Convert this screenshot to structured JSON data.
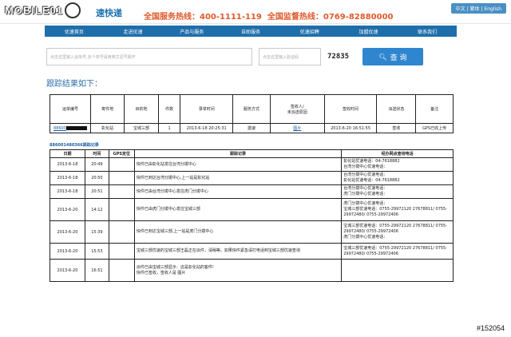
{
  "header": {
    "logo_text": "MOBILE01",
    "brand": "速快递",
    "hotline": "全国服务热线：400-1111-119",
    "supervise": "全国监督热线：0769-82880000",
    "lang": "中文 | 繁体 | English"
  },
  "nav": [
    "优速首页",
    "走进优速",
    "产品与服务",
    "自助服务",
    "优速招聘",
    "加盟优速",
    "联系我们"
  ],
  "search": {
    "placeholder": "点击这里输入运单号,多个单号请用英文逗号隔开",
    "captcha_placeholder": "点击这里输入验证码",
    "captcha": "72835",
    "button": "查 询"
  },
  "result_title": "跟踪结果如下：",
  "table1": {
    "headers": [
      "运单编号",
      "寄件地",
      "目的地",
      "件数",
      "录单时间",
      "服务方式",
      "签收人/\n未派送原因",
      "签收时间",
      "派送状态",
      "备注"
    ],
    "row": {
      "id": "88600",
      "from": "彰化站",
      "to": "宝城三部",
      "count": "1",
      "time": "2013-6-18 20:25:31",
      "service": "激速",
      "signer": "图片",
      "sign_time": "2013-6-20 16:51:55",
      "status": "签收",
      "note": "GPS已收上传"
    }
  },
  "sub_title": "886001480366跟踪记录",
  "table2": {
    "headers": [
      "日期",
      "时间",
      "GPS定位",
      "跟踪记录",
      "经办网点查询电话"
    ],
    "rows": [
      {
        "date": "2013-6-18",
        "time": "20:49",
        "record": "快件已由彰化站发往台湾分拨中心",
        "phone": "彰化站优速电话：04-7618882\n台湾分拨中心优速电话："
      },
      {
        "date": "2013-6-18",
        "time": "20:50",
        "record": "快件已到达台湾分拨中心,上一站是彰化站",
        "phone": "台湾分拨中心优速电话：\n彰化站优速电话：04-7618882"
      },
      {
        "date": "2013-6-18",
        "time": "20:51",
        "record": "快件已由台湾分拨中心发往虎门分拨中心",
        "phone": "台湾分拨中心优速电话：\n虎门分拨中心优速电话："
      },
      {
        "date": "2013-6-20",
        "time": "14:12",
        "record": "快件已由虎门分拨中心发往宝城三部",
        "phone": "虎门分拨中心优速电话：\n宝城三部优速电话：0755-29972120 27678811/ 0755-29972480/ 0755-29972406"
      },
      {
        "date": "2013-6-20",
        "time": "15:39",
        "record": "快件已到达宝城三部,上一站是虎门分拨中心",
        "phone": "宝城三部优速电话：0755-29972120 27678811/ 0755-29972480/ 0755-29972406\n虎门分拨中心优速电话："
      },
      {
        "date": "2013-6-20",
        "time": "15:53",
        "record": "宝城三部优速的宝城三部王磊正在派件，请稍等。如果快件紧急请打电话到宝城三部优速查询",
        "phone": "宝城三部优速电话：0755-29972120 27678811/ 0755-29972480/ 0755-29972406"
      },
      {
        "date": "2013-6-20",
        "time": "16:51",
        "record": "派件已由宝城三部显示：这是彰化站的客件!\n快件已签收，签收人是 图片",
        "phone": ""
      }
    ]
  },
  "watermark": "#152054"
}
